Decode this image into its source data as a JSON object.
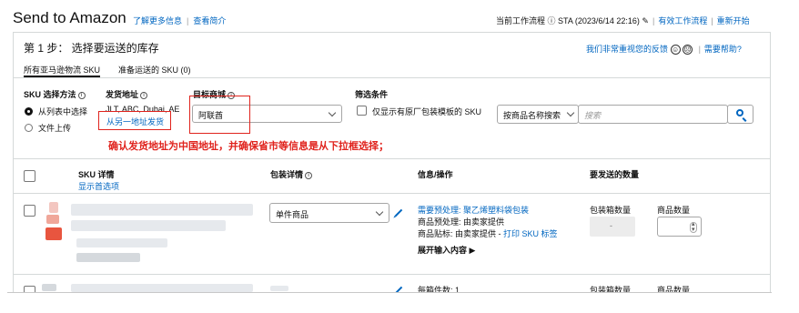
{
  "header": {
    "title": "Send to Amazon",
    "learn_more": "了解更多信息",
    "view_intro": "查看简介",
    "current_workflow": "当前工作流程 ⓘ STA (2023/6/14 22:16)",
    "active_workflows": "有效工作流程",
    "restart": "重新开始"
  },
  "step": {
    "title": "第 1 步： 选择要运送的库存",
    "feedback": "我们非常重视您的反馈",
    "need_help": "需要帮助?"
  },
  "tabs": [
    {
      "label": "所有亚马逊物流 SKU",
      "active": true
    },
    {
      "label": "准备运送的 SKU (0)",
      "active": false
    }
  ],
  "filters": {
    "sku_method_label": "SKU 选择方法",
    "method_options": [
      "从列表中选择",
      "文件上传"
    ],
    "ship_from_label": "发货地址",
    "ship_from_value": "JLT, ABC, Dubai, AE",
    "ship_from_link": "从另一地址发货",
    "marketplace_label": "目标商城",
    "marketplace_value": "阿联酋",
    "filter_label": "筛选条件",
    "filter_checkbox": "仅显示有原厂包装模板的 SKU",
    "search_by": "按商品名称搜索",
    "search_placeholder": "搜索"
  },
  "annotation": "确认发货地址为中国地址，并确保省市等信息是从下拉框选择；",
  "table": {
    "col_sku": "SKU 详情",
    "show_all_options": "显示首选项",
    "col_packaging": "包装详情",
    "col_info": "信息/操作",
    "col_qty": "要发送的数量",
    "rows": [
      {
        "packaging": "单件商品",
        "prep_required": "需要预处理: 聚乙烯塑料袋包装",
        "prep_line2": "商品预处理:  由卖家提供",
        "label_line_prefix": "商品贴标:  由卖家提供 - ",
        "label_link": "打印 SKU 标签",
        "expand": "展开输入内容",
        "boxes_label": "包装箱数量",
        "boxes_value": "-",
        "units_label": "商品数量"
      },
      {
        "info_partial": "每箱件数: 1",
        "boxes_label": "包装箱数量",
        "units_label": "商品数量"
      }
    ]
  },
  "colors": {
    "link": "#0066c0",
    "annotation_red": "#e0231d",
    "border": "#d5d9d9"
  }
}
